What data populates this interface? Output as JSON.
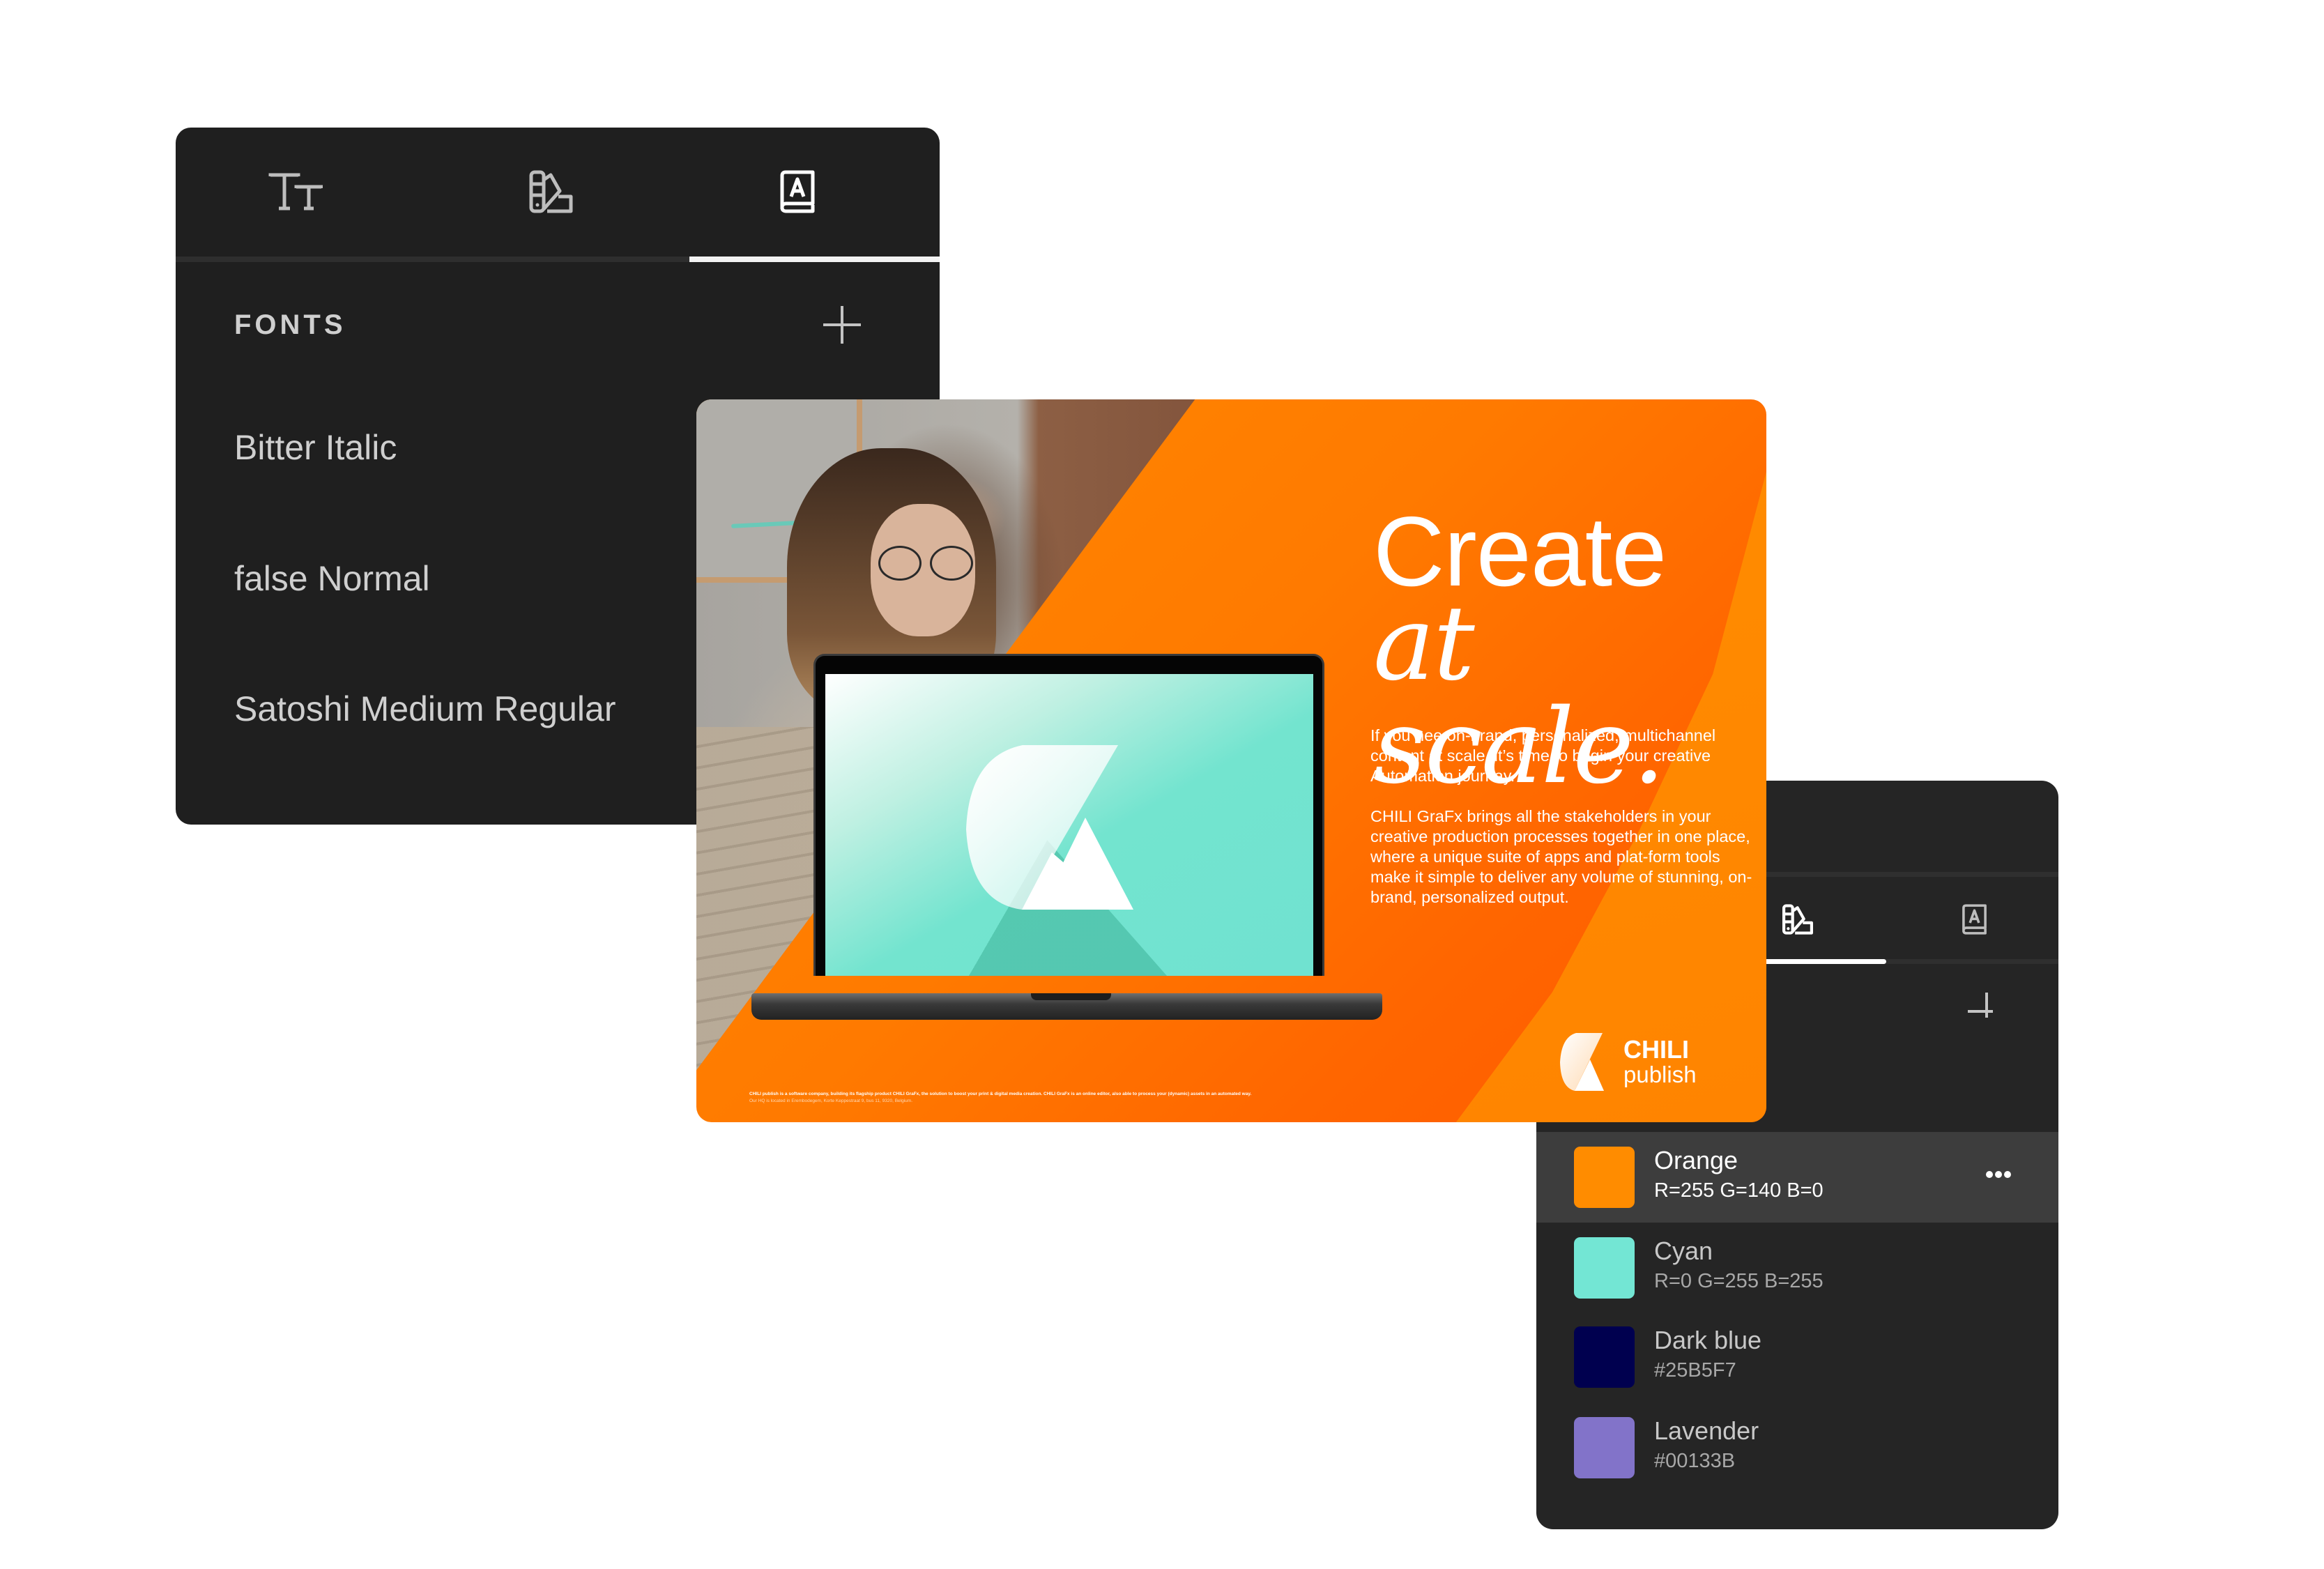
{
  "fonts_panel": {
    "tabs": [
      {
        "icon": "text-size-icon",
        "label": "Text styles",
        "active": false
      },
      {
        "icon": "color-swatches-icon",
        "label": "Colors",
        "active": false
      },
      {
        "icon": "font-book-icon",
        "label": "Fonts",
        "active": true
      }
    ],
    "section_title": "FONTS",
    "add_icon": "plus-icon",
    "fonts": [
      "Bitter Italic",
      "false Normal",
      "Satoshi Medium Regular"
    ]
  },
  "banner": {
    "headline_line1": "Create",
    "headline_line2": "at scale.",
    "paragraph1": "If you nee on-brand, personalized, multichannel content at scale, it’s time to begin your creative Automation journay.",
    "paragraph2": "CHILI GraFx brings all the stakeholders in your creative production processes together in one place, where a unique suite of apps and plat-form tools make it simple to deliver any volume of stunning, on-brand, personalized output.",
    "fineprint1": "CHILI publish is a software company, building its flagship product CHILI GraFx, the solution to boost your print & digital media creation. CHILI GraFx is an online editor, also able to process your (dynamic) assets in an automated way.",
    "fineprint2": "Our HQ is located in Erembodegem, Korte Keppestraat 9, bus 11, 9320, Belgium.",
    "brand_line1": "CHILI",
    "brand_line2": "publish",
    "accent_color": "#FF8C00"
  },
  "colors_panel": {
    "tabs": [
      {
        "icon": "color-swatches-icon",
        "label": "Colors",
        "active": true
      },
      {
        "icon": "font-book-icon",
        "label": "Fonts",
        "active": false
      }
    ],
    "add_icon": "plus-icon",
    "more_icon": "more-horizontal-icon",
    "colors": [
      {
        "name": "Orange",
        "value": "R=255 G=140 B=0",
        "swatch": "#FF8C00",
        "selected": true
      },
      {
        "name": "Cyan",
        "value": "R=0 G=255 B=255",
        "swatch": "#73E6D4",
        "selected": false
      },
      {
        "name": "Dark blue",
        "value": "#25B5F7",
        "swatch": "#00004F",
        "selected": false
      },
      {
        "name": "Lavender",
        "value": "#00133B",
        "swatch": "#8273C9",
        "selected": false
      }
    ]
  }
}
